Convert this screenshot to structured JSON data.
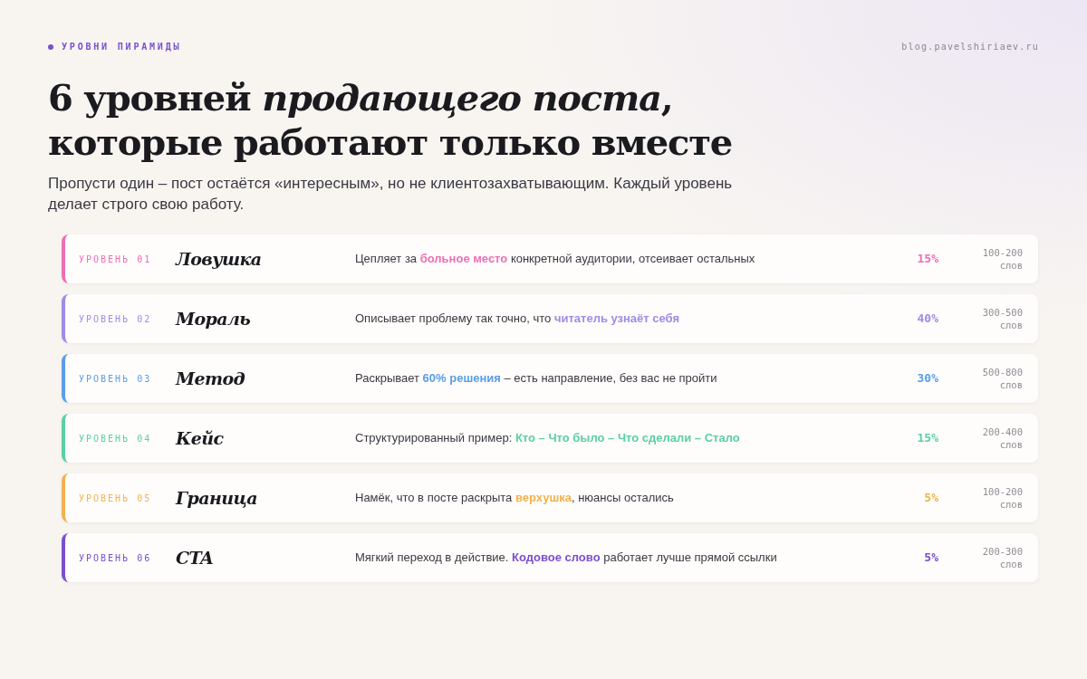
{
  "eyebrow": "УРОВНИ ПИРАМИДЫ",
  "site": "blog.pavelshiriaev.ru",
  "title_lines": [
    "6 уровней *продающего поста*,",
    "которые работают только вместе"
  ],
  "subtitle": "Пропусти один – пост остаётся «интересным», но не клиентозахватывающим. Каждый уровень делает строго свою работу.",
  "levels": [
    {
      "label": "УРОВЕНЬ 01",
      "name": "Ловушка",
      "description": "Цепляет за **больное место** конкретной аудитории, отсеивает остальных",
      "share": "15%",
      "words": "100-200",
      "words_unit": "слов",
      "color": "#ec6fb5"
    },
    {
      "label": "УРОВЕНЬ 02",
      "name": "Мораль",
      "description": "Описывает проблему так точно, что **читатель узнаёт себя**",
      "share": "40%",
      "words": "300-500",
      "words_unit": "слов",
      "color": "#a08be6"
    },
    {
      "label": "УРОВЕНЬ 03",
      "name": "Метод",
      "description": "Раскрывает **60% решения** – есть направление, без вас не пройти",
      "share": "30%",
      "words": "500-800",
      "words_unit": "слов",
      "color": "#5b9ee6"
    },
    {
      "label": "УРОВЕНЬ 04",
      "name": "Кейс",
      "description": "Структурированный пример: **Кто – Что было – Что сделали – Стало**",
      "share": "15%",
      "words": "200-400",
      "words_unit": "слов",
      "color": "#5ccfa5"
    },
    {
      "label": "УРОВЕНЬ 05",
      "name": "Граница",
      "description": "Намёк, что в посте раскрыта **верхушка**, нюансы остались",
      "share": "5%",
      "words": "100-200",
      "words_unit": "слов",
      "color": "#f0b24e"
    },
    {
      "label": "УРОВЕНЬ 06",
      "name": "CTA",
      "description": "Мягкий переход в действие. **Кодовое слово** работает лучше прямой ссылки",
      "share": "5%",
      "words": "200-300",
      "words_unit": "слов",
      "color": "#7a4fcf"
    }
  ]
}
